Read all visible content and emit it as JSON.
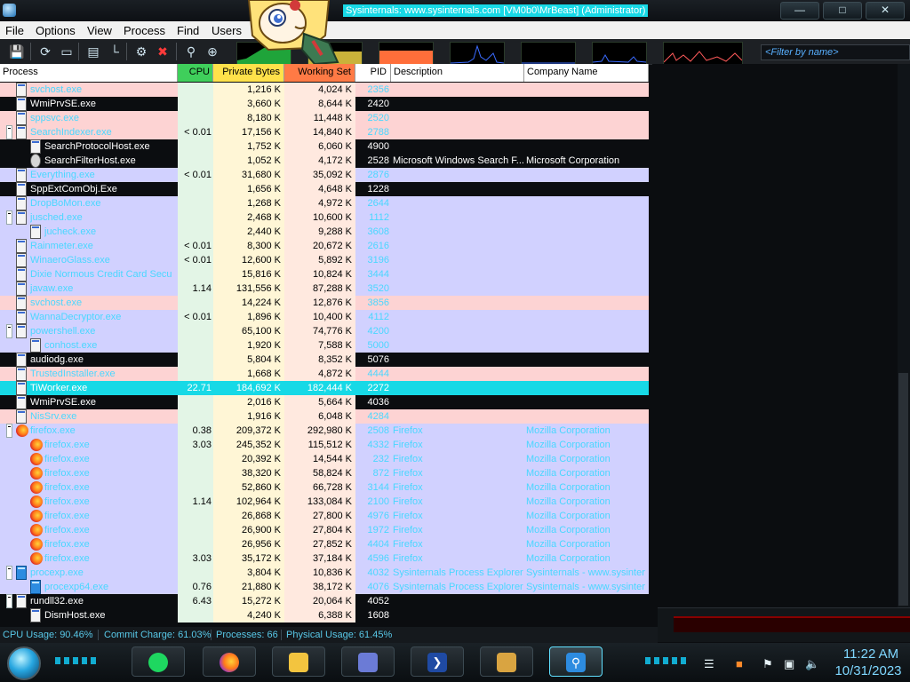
{
  "window": {
    "title": "Sysinternals: www.sysinternals.com [VM0b0\\MrBeast] (Administrator)",
    "controls": [
      "minimize",
      "maximize",
      "close"
    ]
  },
  "menu": [
    {
      "id": "file",
      "label": "File"
    },
    {
      "id": "options",
      "label": "Options"
    },
    {
      "id": "view",
      "label": "View"
    },
    {
      "id": "process",
      "label": "Process"
    },
    {
      "id": "find",
      "label": "Find"
    },
    {
      "id": "users",
      "label": "Users"
    }
  ],
  "toolbar": {
    "buttons": [
      "save-icon",
      "refresh-icon",
      "system-info-icon",
      "graph-icon",
      "tree-icon",
      "target-icon",
      "kill-icon",
      "find-icon",
      "crosshair-icon"
    ],
    "filter_placeholder": "<Filter by name>"
  },
  "columns": {
    "process": "Process",
    "cpu": "CPU",
    "private_bytes": "Private Bytes",
    "working_set": "Working Set",
    "pid": "PID",
    "description": "Description",
    "company": "Company Name"
  },
  "colors": {
    "service_row": "#fdd3d3",
    "own_process_row": "#d1d1ff",
    "system_row": "#0b0d10",
    "highlight_row": "#17d9e6",
    "text_light": "#4ad7ff"
  },
  "processes": [
    {
      "name": "svchost.exe",
      "indent": 1,
      "cpu": "",
      "private_bytes": "1,216 K",
      "working_set": "4,024 K",
      "pid": "2356",
      "description": "",
      "company": "",
      "style": "service",
      "icon": "app"
    },
    {
      "name": "WmiPrvSE.exe",
      "indent": 1,
      "cpu": "",
      "private_bytes": "3,660 K",
      "working_set": "8,644 K",
      "pid": "2420",
      "description": "",
      "company": "",
      "style": "system",
      "icon": "app"
    },
    {
      "name": "sppsvc.exe",
      "indent": 1,
      "cpu": "",
      "private_bytes": "8,180 K",
      "working_set": "11,448 K",
      "pid": "2520",
      "description": "",
      "company": "",
      "style": "service",
      "icon": "app"
    },
    {
      "name": "SearchIndexer.exe",
      "indent": 1,
      "expander": true,
      "cpu": "< 0.01",
      "private_bytes": "17,156 K",
      "working_set": "14,840 K",
      "pid": "2788",
      "description": "",
      "company": "",
      "style": "service",
      "icon": "app"
    },
    {
      "name": "SearchProtocolHost.exe",
      "indent": 2,
      "cpu": "",
      "private_bytes": "1,752 K",
      "working_set": "6,060 K",
      "pid": "4900",
      "description": "",
      "company": "",
      "style": "system",
      "icon": "app"
    },
    {
      "name": "SearchFilterHost.exe",
      "indent": 2,
      "cpu": "",
      "private_bytes": "1,052 K",
      "working_set": "4,172 K",
      "pid": "2528",
      "description": "Microsoft Windows Search F...",
      "company": "Microsoft Corporation",
      "style": "system",
      "icon": "gear"
    },
    {
      "name": "Everything.exe",
      "indent": 1,
      "cpu": "< 0.01",
      "private_bytes": "31,680 K",
      "working_set": "35,092 K",
      "pid": "2876",
      "description": "",
      "company": "",
      "style": "own",
      "icon": "app"
    },
    {
      "name": "SppExtComObj.Exe",
      "indent": 1,
      "cpu": "",
      "private_bytes": "1,656 K",
      "working_set": "4,648 K",
      "pid": "1228",
      "description": "",
      "company": "",
      "style": "system",
      "icon": "app"
    },
    {
      "name": "DropBoMon.exe",
      "indent": 1,
      "cpu": "",
      "private_bytes": "1,268 K",
      "working_set": "4,972 K",
      "pid": "2644",
      "description": "",
      "company": "",
      "style": "own",
      "icon": "app"
    },
    {
      "name": "jusched.exe",
      "indent": 1,
      "expander": true,
      "cpu": "",
      "private_bytes": "2,468 K",
      "working_set": "10,600 K",
      "pid": "1112",
      "description": "",
      "company": "",
      "style": "own",
      "icon": "app"
    },
    {
      "name": "jucheck.exe",
      "indent": 2,
      "cpu": "",
      "private_bytes": "2,440 K",
      "working_set": "9,288 K",
      "pid": "3608",
      "description": "",
      "company": "",
      "style": "own",
      "icon": "app"
    },
    {
      "name": "Rainmeter.exe",
      "indent": 1,
      "cpu": "< 0.01",
      "private_bytes": "8,300 K",
      "working_set": "20,672 K",
      "pid": "2616",
      "description": "",
      "company": "",
      "style": "own",
      "icon": "app"
    },
    {
      "name": "WinaeroGlass.exe",
      "indent": 1,
      "cpu": "< 0.01",
      "private_bytes": "12,600 K",
      "working_set": "5,892 K",
      "pid": "3196",
      "description": "",
      "company": "",
      "style": "own",
      "icon": "app"
    },
    {
      "name": "Dixie Normous Credit Card Secu",
      "indent": 1,
      "cpu": "",
      "private_bytes": "15,816 K",
      "working_set": "10,824 K",
      "pid": "3444",
      "description": "",
      "company": "",
      "style": "own",
      "icon": "app"
    },
    {
      "name": "javaw.exe",
      "indent": 1,
      "cpu": "1.14",
      "private_bytes": "131,556 K",
      "working_set": "87,288 K",
      "pid": "3520",
      "description": "",
      "company": "",
      "style": "own",
      "icon": "app"
    },
    {
      "name": "svchost.exe",
      "indent": 1,
      "cpu": "",
      "private_bytes": "14,224 K",
      "working_set": "12,876 K",
      "pid": "3856",
      "description": "",
      "company": "",
      "style": "service",
      "icon": "app"
    },
    {
      "name": "WannaDecryptor.exe",
      "indent": 1,
      "cpu": "< 0.01",
      "private_bytes": "1,896 K",
      "working_set": "10,400 K",
      "pid": "4112",
      "description": "",
      "company": "",
      "style": "own",
      "icon": "app"
    },
    {
      "name": "powershell.exe",
      "indent": 1,
      "expander": true,
      "cpu": "",
      "private_bytes": "65,100 K",
      "working_set": "74,776 K",
      "pid": "4200",
      "description": "",
      "company": "",
      "style": "own",
      "icon": "app"
    },
    {
      "name": "conhost.exe",
      "indent": 2,
      "cpu": "",
      "private_bytes": "1,920 K",
      "working_set": "7,588 K",
      "pid": "5000",
      "description": "",
      "company": "",
      "style": "own",
      "icon": "app"
    },
    {
      "name": "audiodg.exe",
      "indent": 1,
      "cpu": "",
      "private_bytes": "5,804 K",
      "working_set": "8,352 K",
      "pid": "5076",
      "description": "",
      "company": "",
      "style": "system",
      "icon": "app"
    },
    {
      "name": "TrustedInstaller.exe",
      "indent": 1,
      "cpu": "",
      "private_bytes": "1,668 K",
      "working_set": "4,872 K",
      "pid": "4444",
      "description": "",
      "company": "",
      "style": "service",
      "icon": "app"
    },
    {
      "name": "TiWorker.exe",
      "indent": 1,
      "cpu": "22.71",
      "private_bytes": "184,692 K",
      "working_set": "182,444 K",
      "pid": "2272",
      "description": "",
      "company": "",
      "style": "highlight",
      "icon": "app"
    },
    {
      "name": "WmiPrvSE.exe",
      "indent": 1,
      "cpu": "",
      "private_bytes": "2,016 K",
      "working_set": "5,664 K",
      "pid": "4036",
      "description": "",
      "company": "",
      "style": "system",
      "icon": "app"
    },
    {
      "name": "NisSrv.exe",
      "indent": 1,
      "cpu": "",
      "private_bytes": "1,916 K",
      "working_set": "6,048 K",
      "pid": "4284",
      "description": "",
      "company": "",
      "style": "service",
      "icon": "app"
    },
    {
      "name": "firefox.exe",
      "indent": 1,
      "expander": true,
      "cpu": "0.38",
      "private_bytes": "209,372 K",
      "working_set": "292,980 K",
      "pid": "2508",
      "description": "Firefox",
      "company": "Mozilla Corporation",
      "style": "own",
      "icon": "firefox"
    },
    {
      "name": "firefox.exe",
      "indent": 2,
      "cpu": "3.03",
      "private_bytes": "245,352 K",
      "working_set": "115,512 K",
      "pid": "4332",
      "description": "Firefox",
      "company": "Mozilla Corporation",
      "style": "own",
      "icon": "firefox"
    },
    {
      "name": "firefox.exe",
      "indent": 2,
      "cpu": "",
      "private_bytes": "20,392 K",
      "working_set": "14,544 K",
      "pid": "232",
      "description": "Firefox",
      "company": "Mozilla Corporation",
      "style": "own",
      "icon": "firefox"
    },
    {
      "name": "firefox.exe",
      "indent": 2,
      "cpu": "",
      "private_bytes": "38,320 K",
      "working_set": "58,824 K",
      "pid": "872",
      "description": "Firefox",
      "company": "Mozilla Corporation",
      "style": "own",
      "icon": "firefox"
    },
    {
      "name": "firefox.exe",
      "indent": 2,
      "cpu": "",
      "private_bytes": "52,860 K",
      "working_set": "66,728 K",
      "pid": "3144",
      "description": "Firefox",
      "company": "Mozilla Corporation",
      "style": "own",
      "icon": "firefox"
    },
    {
      "name": "firefox.exe",
      "indent": 2,
      "cpu": "1.14",
      "private_bytes": "102,964 K",
      "working_set": "133,084 K",
      "pid": "2100",
      "description": "Firefox",
      "company": "Mozilla Corporation",
      "style": "own",
      "icon": "firefox"
    },
    {
      "name": "firefox.exe",
      "indent": 2,
      "cpu": "",
      "private_bytes": "26,868 K",
      "working_set": "27,800 K",
      "pid": "4976",
      "description": "Firefox",
      "company": "Mozilla Corporation",
      "style": "own",
      "icon": "firefox"
    },
    {
      "name": "firefox.exe",
      "indent": 2,
      "cpu": "",
      "private_bytes": "26,900 K",
      "working_set": "27,804 K",
      "pid": "1972",
      "description": "Firefox",
      "company": "Mozilla Corporation",
      "style": "own",
      "icon": "firefox"
    },
    {
      "name": "firefox.exe",
      "indent": 2,
      "cpu": "",
      "private_bytes": "26,956 K",
      "working_set": "27,852 K",
      "pid": "4404",
      "description": "Firefox",
      "company": "Mozilla Corporation",
      "style": "own",
      "icon": "firefox"
    },
    {
      "name": "firefox.exe",
      "indent": 2,
      "cpu": "3.03",
      "private_bytes": "35,172 K",
      "working_set": "37,184 K",
      "pid": "4596",
      "description": "Firefox",
      "company": "Mozilla Corporation",
      "style": "own",
      "icon": "firefox"
    },
    {
      "name": "procexp.exe",
      "indent": 1,
      "expander": true,
      "cpu": "",
      "private_bytes": "3,804 K",
      "working_set": "10,836 K",
      "pid": "4032",
      "description": "Sysinternals Process Explorer",
      "company": "Sysinternals - www.sysinter",
      "style": "own",
      "icon": "procexp"
    },
    {
      "name": "procexp64.exe",
      "indent": 2,
      "cpu": "0.76",
      "private_bytes": "21,880 K",
      "working_set": "38,172 K",
      "pid": "4076",
      "description": "Sysinternals Process Explorer",
      "company": "Sysinternals - www.sysinter",
      "style": "own",
      "icon": "procexp"
    },
    {
      "name": "rundll32.exe",
      "indent": 1,
      "expander": true,
      "cpu": "6.43",
      "private_bytes": "15,272 K",
      "working_set": "20,064 K",
      "pid": "4052",
      "description": "",
      "company": "",
      "style": "system",
      "icon": "app"
    },
    {
      "name": "DismHost.exe",
      "indent": 2,
      "cpu": "",
      "private_bytes": "4,240 K",
      "working_set": "6,388 K",
      "pid": "1608",
      "description": "",
      "company": "",
      "style": "system",
      "icon": "app"
    }
  ],
  "status": {
    "cpu_usage": "CPU Usage: 90.46%",
    "commit_charge": "Commit Charge: 61.03%",
    "processes": "Processes: 66",
    "physical_usage": "Physical Usage: 61.45%"
  },
  "taskbar": {
    "apps": [
      {
        "id": "spotify",
        "icon": "spotify-icon"
      },
      {
        "id": "firefox",
        "icon": "firefox-icon"
      },
      {
        "id": "file-explorer",
        "icon": "folder-icon"
      },
      {
        "id": "control-panel",
        "icon": "control-panel-icon"
      },
      {
        "id": "powershell",
        "icon": "powershell-icon"
      },
      {
        "id": "handshake",
        "icon": "handshake-icon"
      },
      {
        "id": "process-explorer",
        "icon": "magnifier-icon",
        "active": true
      }
    ],
    "tray": [
      "show-desktop-icon",
      "action-center-icon",
      "flag-icon",
      "network-icon",
      "volume-icon"
    ],
    "time": "11:22 AM",
    "date": "10/31/2023"
  }
}
